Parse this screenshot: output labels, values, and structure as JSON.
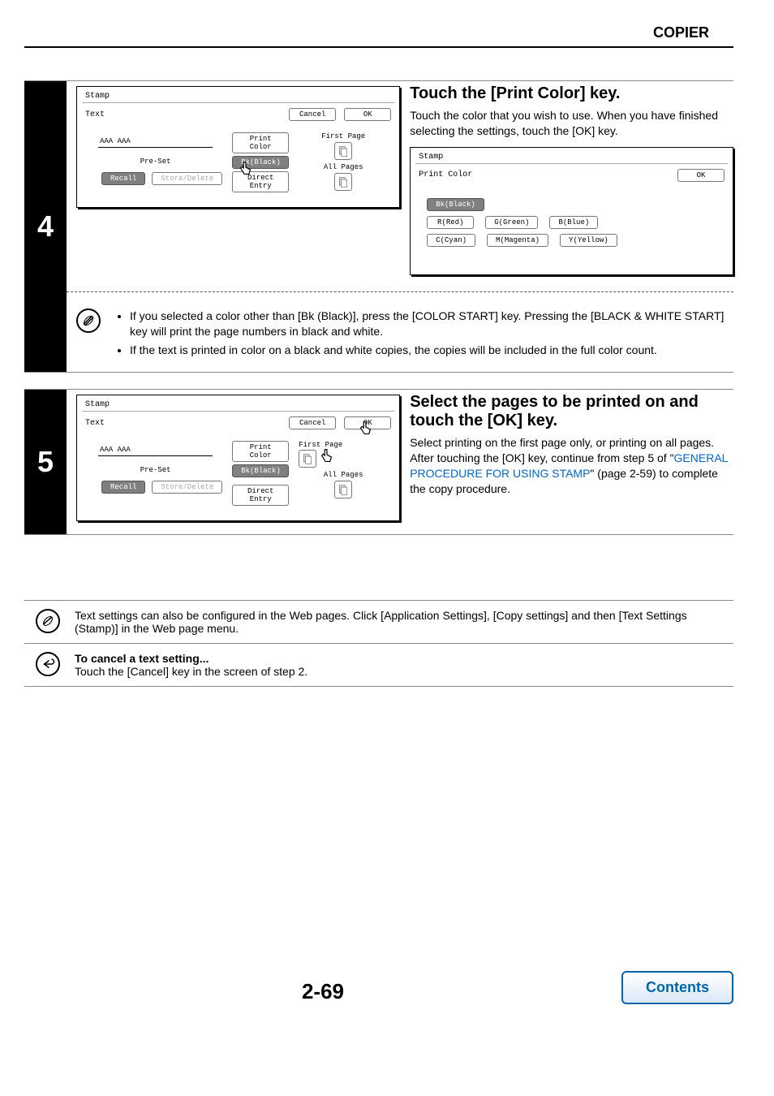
{
  "header": {
    "title": "COPIER"
  },
  "step4": {
    "number": "4",
    "heading": "Touch the [Print Color] key.",
    "para": "Touch the color that you wish to use. When you have finished selecting the settings, touch the [OK] key.",
    "screen_left": {
      "title": "Stamp",
      "subtitle": "Text",
      "cancel": "Cancel",
      "ok": "OK",
      "entry": "AAA AAA",
      "preset": "Pre-Set",
      "recall": "Recall",
      "store_delete": "Store/Delete",
      "print_color": "Print Color",
      "bk_black": "Bk(Black)",
      "direct_entry": "Direct Entry",
      "first_page": "First Page",
      "all_pages": "All Pages"
    },
    "screen_right": {
      "title": "Stamp",
      "subtitle": "Print Color",
      "ok": "OK",
      "colors": {
        "bk": "Bk(Black)",
        "r": "R(Red)",
        "g": "G(Green)",
        "b": "B(Blue)",
        "c": "C(Cyan)",
        "m": "M(Magenta)",
        "y": "Y(Yellow)"
      }
    },
    "notes": [
      "If you selected a color other than [Bk (Black)], press the [COLOR START] key. Pressing the [BLACK & WHITE START] key will print the page numbers in black and white.",
      "If the text is printed in color on a black and white copies, the copies will be included in the full color count."
    ]
  },
  "step5": {
    "number": "5",
    "heading": "Select the pages to be printed on and touch the [OK] key.",
    "para_prefix": "Select printing on the first page only, or printing on all pages. After touching the [OK] key, continue from step 5 of \"",
    "link_text": "GENERAL PROCEDURE FOR USING STAMP",
    "para_suffix": "\" (page 2-59) to complete the copy procedure.",
    "screen": {
      "title": "Stamp",
      "subtitle": "Text",
      "cancel": "Cancel",
      "ok": "OK",
      "entry": "AAA AAA",
      "preset": "Pre-Set",
      "recall": "Recall",
      "store_delete": "Store/Delete",
      "print_color": "Print Color",
      "bk_black": "Bk(Black)",
      "direct_entry": "Direct Entry",
      "first_page": "First Page",
      "all_pages": "All Pages"
    }
  },
  "bottom_notes": {
    "note1": "Text settings can also be configured in the Web pages. Click [Application Settings], [Copy settings] and then [Text Settings (Stamp)] in the Web page menu.",
    "note2_title": "To cancel a text setting...",
    "note2_body": "Touch the [Cancel] key in the screen of step 2."
  },
  "footer": {
    "page_num": "2-69",
    "contents": "Contents"
  }
}
